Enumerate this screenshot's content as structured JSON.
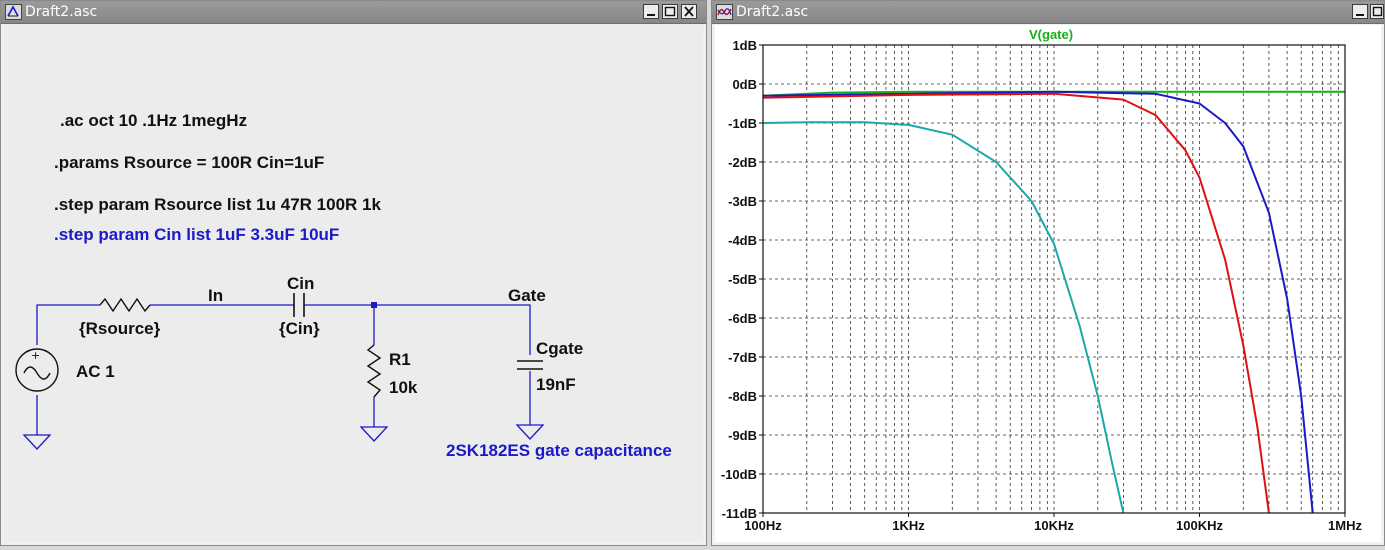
{
  "windows": {
    "schematic": {
      "title": "Draft2.asc"
    },
    "waveform": {
      "title": "Draft2.asc"
    }
  },
  "schematic": {
    "directives": {
      "ac": ".ac oct 10 .1Hz 1megHz",
      "params": ".params Rsource = 100R Cin=1uF",
      "step_rsource": ".step param Rsource list 1u 47R 100R 1k",
      "step_cin": ".step param Cin list 1uF 3.3uF 10uF"
    },
    "labels": {
      "net_in": "In",
      "net_gate": "Gate",
      "rsource_value": "{Rsource}",
      "cin_name": "Cin",
      "cin_value": "{Cin}",
      "r1_name": "R1",
      "r1_value": "10k",
      "cgate_name": "Cgate",
      "cgate_value": "19nF",
      "source_value": "AC 1",
      "comment": "2SK182ES gate capacitance"
    },
    "colors": {
      "wire": "#1a1ac8",
      "text": "#111111",
      "comment": "#1a1ac8"
    }
  },
  "chart_data": {
    "type": "line",
    "title": "V(gate)",
    "xlabel": "",
    "ylabel": "",
    "x_scale": "log",
    "xlim": [
      100,
      1000000
    ],
    "ylim": [
      -11,
      1
    ],
    "grid": true,
    "x_tick_labels": [
      "100Hz",
      "1KHz",
      "10KHz",
      "100KHz",
      "1MHz"
    ],
    "y_tick_labels": [
      "1dB",
      "0dB",
      "-1dB",
      "-2dB",
      "-3dB",
      "-4dB",
      "-5dB",
      "-6dB",
      "-7dB",
      "-8dB",
      "-9dB",
      "-10dB",
      "-11dB"
    ],
    "title_color": "#17b017",
    "series": [
      {
        "color": "#17b017",
        "x": [
          100,
          300,
          1000,
          10000,
          100000,
          1000000
        ],
        "y": [
          -0.3,
          -0.22,
          -0.2,
          -0.2,
          -0.2,
          -0.2
        ]
      },
      {
        "color": "#1a1ac8",
        "x": [
          100,
          1000,
          10000,
          50000,
          100000,
          150000,
          200000,
          300000,
          400000,
          500000,
          600000
        ],
        "y": [
          -0.3,
          -0.25,
          -0.2,
          -0.25,
          -0.5,
          -1.0,
          -1.6,
          -3.3,
          -5.5,
          -8.0,
          -11.0
        ]
      },
      {
        "color": "#e01010",
        "x": [
          100,
          1000,
          10000,
          30000,
          50000,
          80000,
          100000,
          150000,
          200000,
          250000,
          300000
        ],
        "y": [
          -0.35,
          -0.28,
          -0.25,
          -0.4,
          -0.8,
          -1.7,
          -2.4,
          -4.5,
          -6.7,
          -8.8,
          -11.0
        ]
      },
      {
        "color": "#1aa8a8",
        "x": [
          100,
          200,
          500,
          1000,
          2000,
          4000,
          7000,
          10000,
          15000,
          20000,
          25000,
          30000
        ],
        "y": [
          -1.0,
          -0.98,
          -0.98,
          -1.05,
          -1.3,
          -2.0,
          -3.0,
          -4.1,
          -6.2,
          -8.0,
          -9.7,
          -11.0
        ]
      }
    ]
  }
}
